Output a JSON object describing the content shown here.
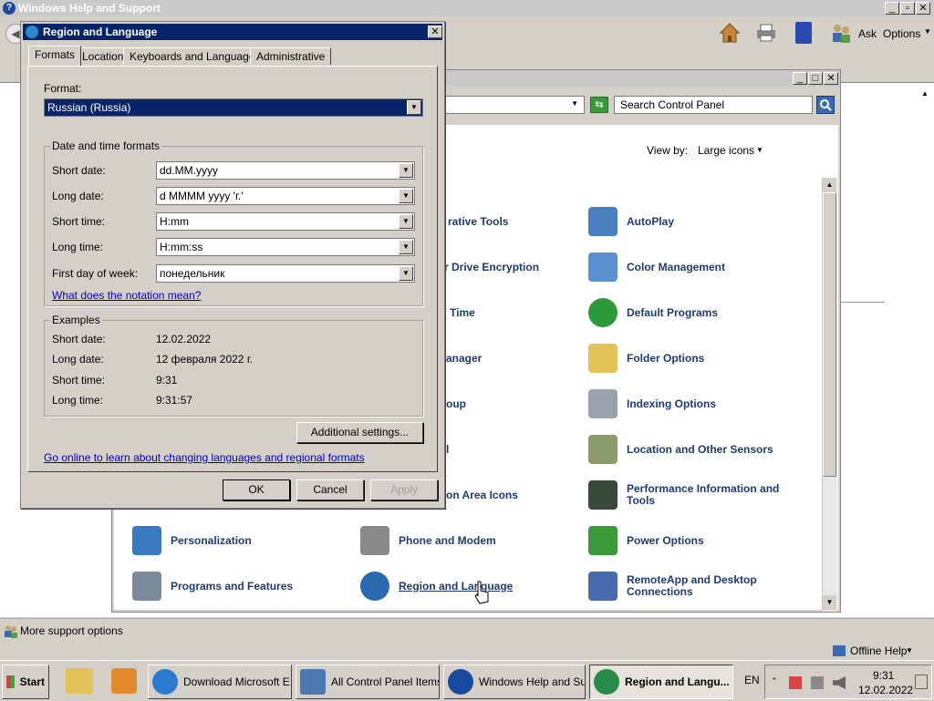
{
  "help_window": {
    "title": "Windows Help and Support",
    "toolbar": {
      "ask": "Ask",
      "options": "Options"
    },
    "status": {
      "more_support": "More support options",
      "offline_help": "Offline Help"
    }
  },
  "control_panel": {
    "search_placeholder": "Search Control Panel",
    "view_by_label": "View by:",
    "view_by_value": "Large icons",
    "items_left_partial": [
      "rative Tools",
      "r Drive Encryption",
      "Time",
      "anager",
      "oup",
      "l",
      "on Area Icons"
    ],
    "items": [
      {
        "label": "AutoPlay",
        "color": "#4a7fc0"
      },
      {
        "label": "Color Management",
        "color": "#5a8fd0"
      },
      {
        "label": "Default Programs",
        "color": "#2a9a3a"
      },
      {
        "label": "Folder Options",
        "color": "#e4c25a"
      },
      {
        "label": "Indexing Options",
        "color": "#9aa3ad"
      },
      {
        "label": "Location and Other Sensors",
        "color": "#8a9a6a"
      },
      {
        "label": "Performance Information and Tools",
        "color": "#3a4a3a"
      },
      {
        "label": "Power Options",
        "color": "#3a9a3a"
      },
      {
        "label": "Personalization",
        "color": "#3a7ac0"
      },
      {
        "label": "Phone and Modem",
        "color": "#8a8a8a"
      },
      {
        "label": "Programs and Features",
        "color": "#7a8a9a"
      },
      {
        "label": "Region and Language",
        "color": "#2a6ab0"
      },
      {
        "label": "RemoteApp and Desktop Connections",
        "color": "#4a6ab0"
      }
    ]
  },
  "dialog": {
    "title": "Region and Language",
    "tabs": [
      "Formats",
      "Location",
      "Keyboards and Languages",
      "Administrative"
    ],
    "format_label": "Format:",
    "format_value": "Russian (Russia)",
    "dt_group": "Date and time formats",
    "rows": [
      {
        "label": "Short date:",
        "value": "dd.MM.yyyy"
      },
      {
        "label": "Long date:",
        "value": "d MMMM yyyy 'г.'"
      },
      {
        "label": "Short time:",
        "value": "H:mm"
      },
      {
        "label": "Long time:",
        "value": "H:mm:ss"
      },
      {
        "label": "First day of week:",
        "value": "понедельник"
      }
    ],
    "notation_link": "What does the notation mean?",
    "examples_group": "Examples",
    "examples": [
      {
        "label": "Short date:",
        "value": "12.02.2022"
      },
      {
        "label": "Long date:",
        "value": "12 февраля 2022 г."
      },
      {
        "label": "Short time:",
        "value": "9:31"
      },
      {
        "label": "Long time:",
        "value": "9:31:57"
      }
    ],
    "additional_button": "Additional settings...",
    "online_link": "Go online to learn about changing languages and regional formats",
    "ok": "OK",
    "cancel": "Cancel",
    "apply": "Apply"
  },
  "taskbar": {
    "start": "Start",
    "tasks": [
      {
        "label": "Download Microsoft E...",
        "color": "#2a7ad0"
      },
      {
        "label": "All Control Panel Items",
        "color": "#4a7ab0"
      },
      {
        "label": "Windows Help and Su...",
        "color": "#1a4aa0"
      },
      {
        "label": "Region and Langu...",
        "color": "#2a8a4a"
      }
    ],
    "lang": "EN",
    "time": "9:31",
    "date": "12.02.2022"
  }
}
